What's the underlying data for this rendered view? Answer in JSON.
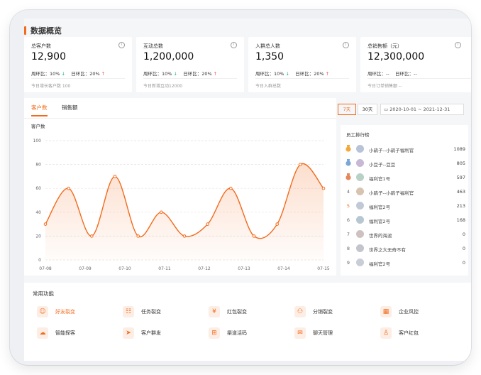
{
  "title": "数据概览",
  "stats": [
    {
      "label": "总客户数",
      "value": "12,900",
      "week": "周环比：10%",
      "day": "日环比：20%",
      "sub": "今日增长客户数 100"
    },
    {
      "label": "互动总数",
      "value": "1,200,000",
      "week": "周环比：10%",
      "day": "日环比：20%",
      "sub": "今日新增互动12000"
    },
    {
      "label": "入群总人数",
      "value": "1,350",
      "week": "周环比：10%",
      "day": "日环比：20%",
      "sub": "今日入群总数"
    },
    {
      "label": "总销售额（元）",
      "value": "12,300,000",
      "week": "周环比：--",
      "day": "日环比：--",
      "sub": "今日订单销售额 --"
    }
  ],
  "chart_tabs": [
    "客户数",
    "销售额"
  ],
  "ranges": [
    "7天",
    "30天"
  ],
  "date_range": "2020-10-01 ~ 2021-12-31",
  "chart_title": "客户数",
  "chart_data": {
    "type": "line",
    "title": "客户数",
    "x": [
      "07-08",
      "",
      "07-09",
      "",
      "07-10",
      "",
      "07-11",
      "",
      "07-12",
      "",
      "07-13",
      "",
      "07-14",
      "",
      "07-15"
    ],
    "xticks": [
      "07-08",
      "07-09",
      "07-10",
      "07-11",
      "07-12",
      "07-13",
      "07-14",
      "07-15"
    ],
    "values": [
      30,
      60,
      20,
      70,
      20,
      40,
      20,
      30,
      60,
      20,
      30,
      80,
      60
    ],
    "yticks": [
      0,
      20,
      40,
      60,
      80,
      100
    ],
    "ylim": [
      0,
      100
    ],
    "color": "#f26b1d"
  },
  "rank": {
    "title": "员工排行榜",
    "rows": [
      {
        "num": "1",
        "name": "小鹃子--小鹃子福利官",
        "score": "1089"
      },
      {
        "num": "2",
        "name": "小豆子--豆豆",
        "score": "805"
      },
      {
        "num": "3",
        "name": "福利官1号",
        "score": "597"
      },
      {
        "num": "4",
        "name": "小鹃子--小鹃子福利官",
        "score": "463"
      },
      {
        "num": "5",
        "name": "福利官2号",
        "score": "213"
      },
      {
        "num": "6",
        "name": "福利官2号",
        "score": "168"
      },
      {
        "num": "7",
        "name": "世界的海滤",
        "score": "0"
      },
      {
        "num": "8",
        "name": "世界之大无奇不有",
        "score": "0"
      },
      {
        "num": "9",
        "name": "福利官2号",
        "score": "0"
      }
    ]
  },
  "functions": {
    "title": "常用功能",
    "items": [
      {
        "label": "好友裂变",
        "icon": "friends-icon"
      },
      {
        "label": "任务裂变",
        "icon": "task-icon"
      },
      {
        "label": "红包裂变",
        "icon": "redpacket-icon"
      },
      {
        "label": "分销裂变",
        "icon": "distribution-icon"
      },
      {
        "label": "企业风控",
        "icon": "building-icon"
      },
      {
        "label": "智能探客",
        "icon": "cloud-icon"
      },
      {
        "label": "客户群发",
        "icon": "send-icon"
      },
      {
        "label": "渠道活码",
        "icon": "qrcode-icon"
      },
      {
        "label": "聊天管理",
        "icon": "chat-icon"
      },
      {
        "label": "客户红包",
        "icon": "user-gift-icon"
      }
    ]
  }
}
